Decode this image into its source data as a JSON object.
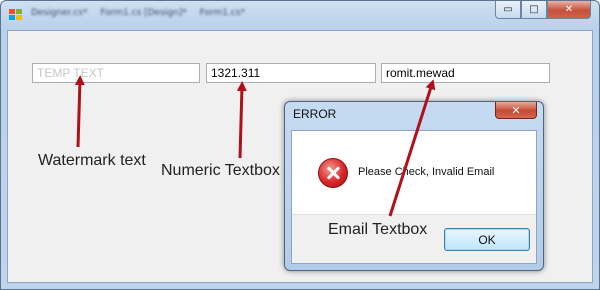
{
  "window": {
    "title_blurred": [
      "Designer.cs*",
      "Form1.cs [Design]*",
      "Form1.cs*"
    ],
    "caption": {
      "minimize": "▭",
      "maximize": "□",
      "close": "✕"
    }
  },
  "textboxes": {
    "watermark": "TEMP TEXT",
    "numeric": "1321.311",
    "email": "romit.mewad"
  },
  "annotations": {
    "watermark": "Watermark text",
    "numeric": "Numeric Textbox",
    "email": "Email Textbox"
  },
  "dialog": {
    "title": "ERROR",
    "close": "✕",
    "message": "Please Check, Invalid Email",
    "ok_label": "OK"
  },
  "colors": {
    "arrow": "#b0101a",
    "error_icon": "#d9262a",
    "close_button": "#c5513c"
  },
  "icons": [
    "app-icon",
    "error-icon",
    "close-icon",
    "minimize-icon",
    "maximize-icon"
  ]
}
